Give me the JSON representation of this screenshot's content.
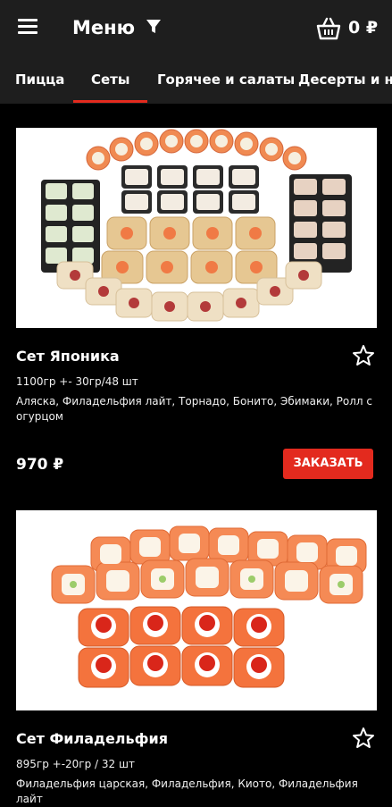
{
  "header": {
    "title": "Меню",
    "cart_count": "0 ₽",
    "icons": [
      "hamburger-menu-icon",
      "filter-icon",
      "shopping-basket-icon"
    ]
  },
  "tabs": [
    {
      "label": "Пицца",
      "active": false
    },
    {
      "label": "Сеты",
      "active": true
    },
    {
      "label": "Горячее и салаты",
      "active": false
    },
    {
      "label": "Десерты и нап",
      "active": false
    }
  ],
  "products": [
    {
      "name": "Сет Японика",
      "weight": "1100гр +- 30гр/48 шт",
      "description": "Аляска, Филадельфия лайт, Торнадо, Бонито, Эбимаки, Ролл с огурцом",
      "price": "970 ₽",
      "order_label": "ЗАКАЗАТЬ"
    },
    {
      "name": "Сет Филадельфия",
      "weight": "895гр +-20гр / 32 шт",
      "description": "Филадельфия царская, Филадельфия, Киото, Филадельфия лайт"
    }
  ],
  "colors": {
    "background": "#000000",
    "appbar": "#1e1e1e",
    "accent": "#e32a1e",
    "text": "#ffffff"
  }
}
